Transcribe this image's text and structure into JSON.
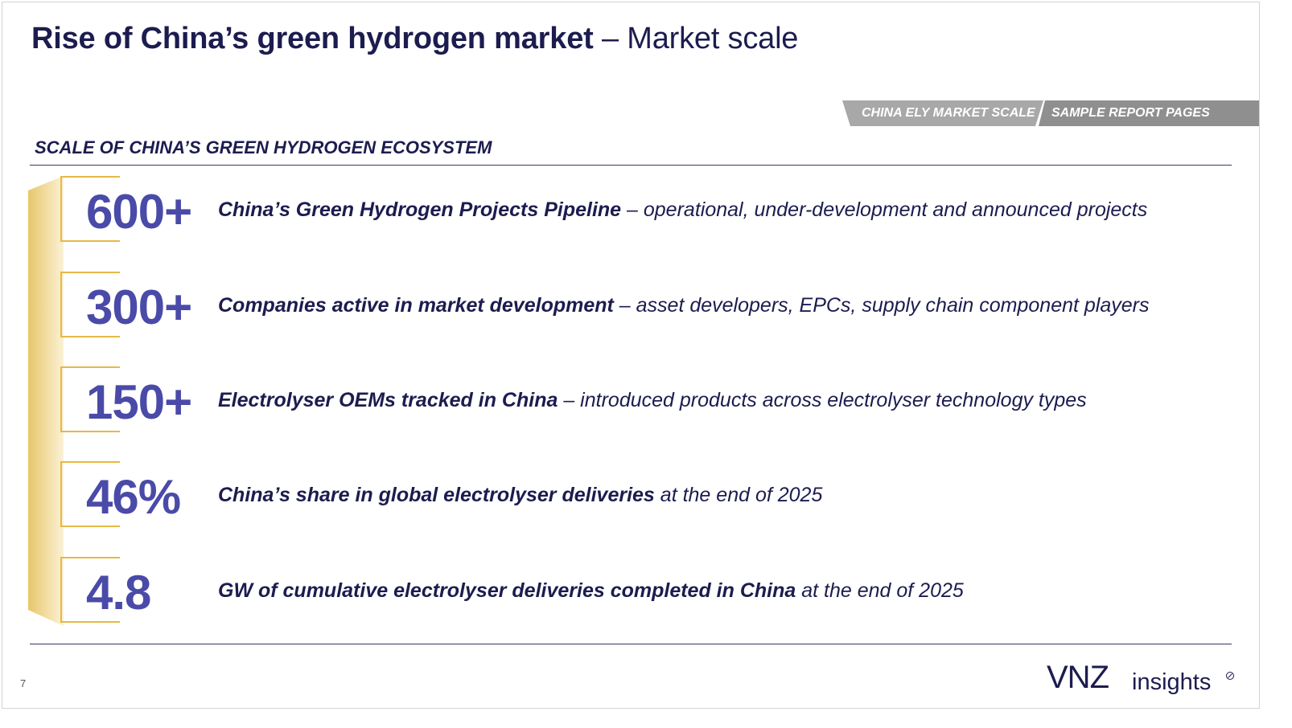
{
  "header": {
    "title_bold": "Rise of China’s green hydrogen market",
    "title_rest": " – Market scale"
  },
  "tags": {
    "tag1": "CHINA ELY MARKET SCALE",
    "tag2": "SAMPLE REPORT PAGES"
  },
  "section": {
    "title": "SCALE OF CHINA’S GREEN HYDROGEN ECOSYSTEM"
  },
  "stats": [
    {
      "value": "600+",
      "label_bold": "China’s Green Hydrogen Projects Pipeline",
      "label_rest": " – operational, under-development  and announced projects"
    },
    {
      "value": "300+",
      "label_bold": "Companies active in market development",
      "label_rest": " – asset developers, EPCs, supply chain component players"
    },
    {
      "value": "150+",
      "label_bold": "Electrolyser OEMs tracked in China",
      "label_rest": " – introduced products across electrolyser technology types"
    },
    {
      "value": "46%",
      "label_bold": "China’s share in global electrolyser deliveries",
      "label_rest": " at the end of 2025"
    },
    {
      "value": "4.8",
      "label_bold": "GW of cumulative electrolyser deliveries completed in China",
      "label_rest": " at the end of 2025"
    }
  ],
  "footer": {
    "page_number": "7",
    "logo_mark": "VNZ",
    "logo_word": "insights"
  },
  "colors": {
    "navy": "#1c1c4f",
    "stat_purple": "#4a4aa8",
    "gold": "#e6b944",
    "tag_grey": "#9a9a9a"
  }
}
